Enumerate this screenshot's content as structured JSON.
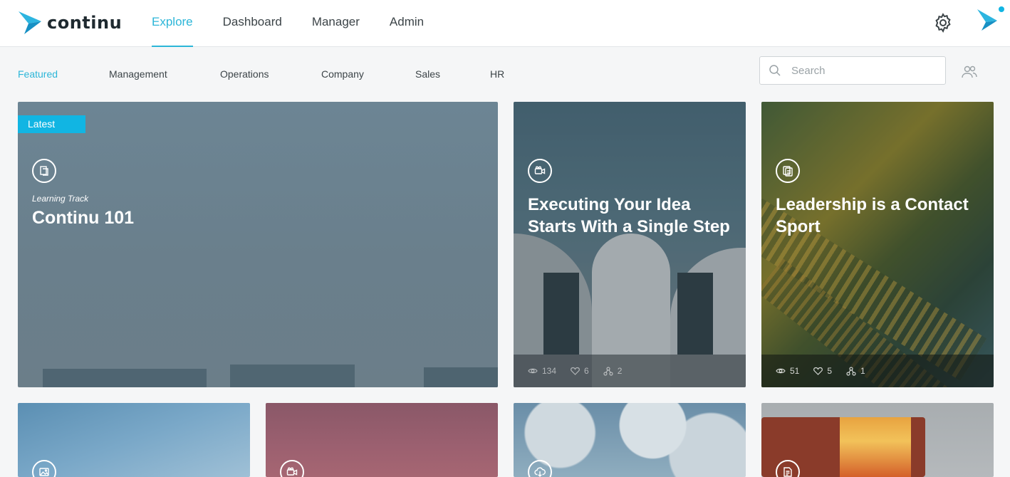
{
  "app": {
    "logo_text": "continu"
  },
  "nav": {
    "items": [
      {
        "label": "Explore",
        "active": true
      },
      {
        "label": "Dashboard",
        "active": false
      },
      {
        "label": "Manager",
        "active": false
      },
      {
        "label": "Admin",
        "active": false
      }
    ]
  },
  "subnav": {
    "items": [
      {
        "label": "Featured",
        "active": true
      },
      {
        "label": "Management",
        "active": false
      },
      {
        "label": "Operations",
        "active": false
      },
      {
        "label": "Company",
        "active": false
      },
      {
        "label": "Sales",
        "active": false
      },
      {
        "label": "HR",
        "active": false
      }
    ]
  },
  "search": {
    "placeholder": "Search",
    "value": ""
  },
  "featured": {
    "badge": "Latest",
    "type": "Learning Track",
    "title": "Continu 101",
    "icon": "document-copy-icon"
  },
  "cards": [
    {
      "title": "Executing Your Idea Starts With a Single Step",
      "icon": "video-camera-icon",
      "views": "134",
      "likes": "6",
      "shares": "2"
    },
    {
      "title": "Leadership is a Contact Sport",
      "icon": "documents-icon",
      "views": "51",
      "likes": "5",
      "shares": "1"
    }
  ],
  "bottom_cards": [
    {
      "icon": "image-icon"
    },
    {
      "icon": "video-camera-icon"
    },
    {
      "icon": "cloud-download-icon"
    },
    {
      "icon": "document-icon"
    }
  ],
  "colors": {
    "accent": "#2cb6d8",
    "badge": "#11b5e3",
    "nav_text": "#3c4448"
  }
}
